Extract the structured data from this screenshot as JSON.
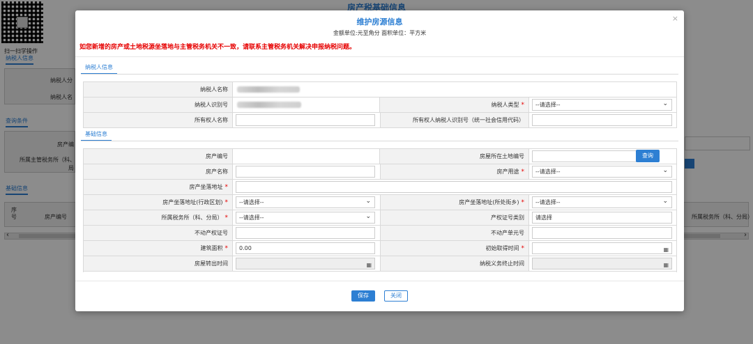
{
  "background": {
    "page_title": "房产税基础信息",
    "scan_label": "扫一扫学操作",
    "section_taxpayer": "纳税人信息",
    "taxpayer_label_1": "纳税人分",
    "taxpayer_label_2": "纳税人名",
    "section_query": "查询条件",
    "query_label_1": "房产编",
    "query_label_2": "所属主管税务所（科、",
    "query_label_2b": "局",
    "section_basic": "基础信息",
    "table_col_seq_1": "序",
    "table_col_seq_2": "号",
    "table_col_code": "房产编号",
    "table_col_office": "所属税务所（科、分局）"
  },
  "modal": {
    "title": "维护房源信息",
    "subtitle": "金额单位:元至角分 面积单位：平方米",
    "warning": "如您新增的房产或土地税源坐落地与主管税务机关不一致，请联系主管税务机关解决申报纳税问题。",
    "close_glyph": "×",
    "taxpayer_section": {
      "tab_label": "纳税人信息",
      "name_label": "纳税人名称",
      "id_label": "纳税人识别号",
      "type_label": "纳税人类型",
      "type_value": "--请选择--",
      "owner_name_label": "所有权人名称",
      "owner_name_value": "",
      "owner_id_label": "所有权人纳税人识别号（统一社会信用代码）",
      "owner_id_value": ""
    },
    "basic_section": {
      "tab_label": "基础信息",
      "property_code_label": "房产编号",
      "land_code_label": "房屋所在土地编号",
      "land_code_value": "",
      "query_button": "查询",
      "property_name_label": "房产名称",
      "property_name_value": "",
      "usage_label": "房产用途",
      "usage_value": "--请选择--",
      "address_label": "房产坐落地址",
      "address_value": "",
      "district_label": "房产坐落地址(行政区划)",
      "district_value": "--请选择--",
      "street_label": "房产坐落地址(所处街乡)",
      "street_value": "--请选择--",
      "tax_office_label": "所属税务所（科、分局）",
      "tax_office_value": "--请选择--",
      "cert_type_label": "产权证号类别",
      "cert_type_value": "请选择",
      "cert_no_label": "不动产权证号",
      "cert_no_value": "",
      "unit_no_label": "不动产单元号",
      "unit_no_value": "",
      "area_label": "建筑面积",
      "area_value": "0.00",
      "acquire_date_label": "初始取得时间",
      "acquire_date_value": "",
      "transfer_date_label": "房屋转出时间",
      "transfer_date_value": "",
      "end_date_label": "纳税义务终止时间",
      "end_date_value": ""
    },
    "save_button": "保存",
    "close_button": "关闭"
  },
  "icons": {
    "chevron": "chevron-down-icon",
    "calendar": "calendar-icon"
  },
  "colors": {
    "accent": "#2d7fd3",
    "required": "#e60000",
    "label_bg": "#f2f2f2"
  }
}
